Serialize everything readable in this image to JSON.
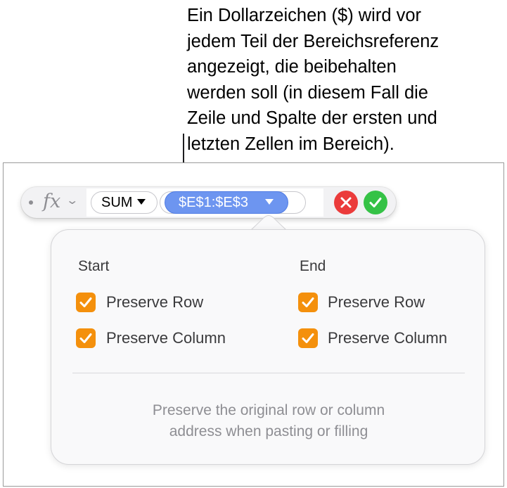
{
  "callout": {
    "text": "Ein Dollarzeichen ($) wird vor\njedem Teil der Bereichsreferenz\nangezeigt, die beibehalten\nwerden soll (in diesem Fall die\nZeile und Spalte der ersten und\nletzten Zellen im Bereich)."
  },
  "formula_bar": {
    "fx_icon": "fx-icon",
    "fx_label": "fx",
    "chevron_icon": "chevron-down-icon",
    "function_token": "SUM",
    "range_token": "$E$1:$E$3",
    "cancel_icon": "close-icon",
    "accept_icon": "checkmark-icon",
    "colors": {
      "range_fill": "#6d95f0",
      "cancel": "#eb3b3b",
      "accept": "#35c246"
    }
  },
  "popover": {
    "start": {
      "heading": "Start",
      "preserve_row": {
        "label": "Preserve Row",
        "checked": true
      },
      "preserve_column": {
        "label": "Preserve Column",
        "checked": true
      }
    },
    "end": {
      "heading": "End",
      "preserve_row": {
        "label": "Preserve Row",
        "checked": true
      },
      "preserve_column": {
        "label": "Preserve Column",
        "checked": true
      }
    },
    "help_text": "Preserve the original row or column\naddress when pasting or filling",
    "checkbox_color": "#f4900c"
  }
}
